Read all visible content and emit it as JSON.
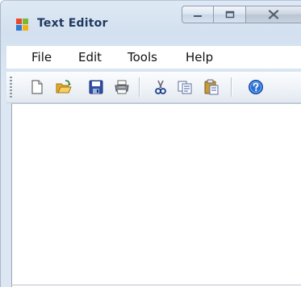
{
  "window": {
    "title": "Text Editor",
    "app_icon": "windows-app-icon"
  },
  "caption_buttons": [
    {
      "name": "minimize-button",
      "icon": "minimize-icon"
    },
    {
      "name": "maximize-button",
      "icon": "maximize-icon"
    },
    {
      "name": "close-button",
      "icon": "close-icon"
    }
  ],
  "menu": {
    "file": "File",
    "edit": "Edit",
    "tools": "Tools",
    "help": "Help"
  },
  "toolbar": {
    "icons": [
      "new-document-icon",
      "open-folder-icon",
      "save-icon",
      "print-icon",
      "cut-icon",
      "copy-icon",
      "paste-icon",
      "help-icon"
    ]
  },
  "editor": {
    "text": ""
  },
  "colors": {
    "title": "#1e3a5f",
    "chrome": "#dce7f3",
    "help_blue": "#2a6fd6"
  }
}
